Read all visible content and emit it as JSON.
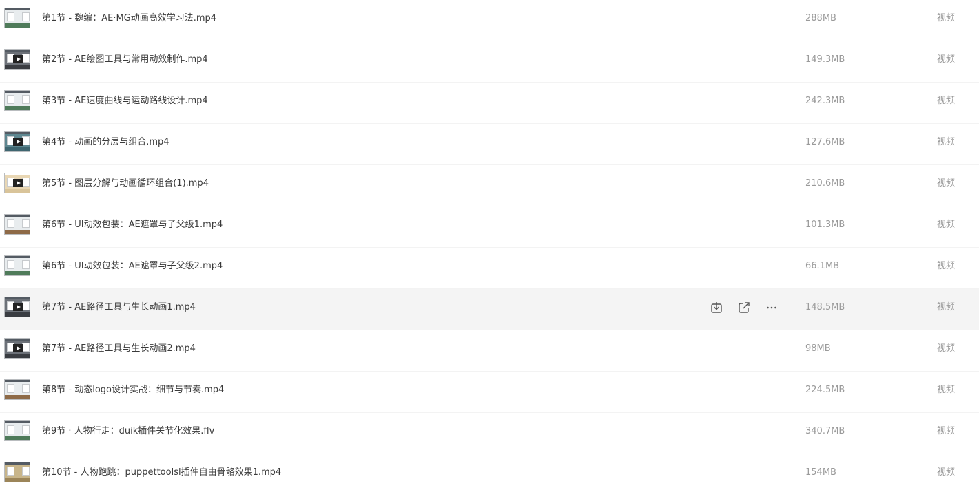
{
  "rows": [
    {
      "name": "第1节 - 魏编：AE·MG动画高效学习法.mp4",
      "size": "288MB",
      "type": "视频",
      "thumb": "t-light",
      "hovered": false
    },
    {
      "name": "第2节 - AE绘图工具与常用动效制作.mp4",
      "size": "149.3MB",
      "type": "视频",
      "thumb": "t-dark",
      "hovered": false
    },
    {
      "name": "第3节 - AE速度曲线与运动路线设计.mp4",
      "size": "242.3MB",
      "type": "视频",
      "thumb": "t-light",
      "hovered": false
    },
    {
      "name": "第4节 - 动画的分层与组合.mp4",
      "size": "127.6MB",
      "type": "视频",
      "thumb": "t-teal",
      "hovered": false
    },
    {
      "name": "第5节 - 图层分解与动画循环组合(1).mp4",
      "size": "210.6MB",
      "type": "视频",
      "thumb": "t-beige",
      "hovered": false
    },
    {
      "name": "第6节 - UI动效包装：AE遮罩与子父级1.mp4",
      "size": "101.3MB",
      "type": "视频",
      "thumb": "t-brown",
      "hovered": false
    },
    {
      "name": "第6节 - UI动效包装：AE遮罩与子父级2.mp4",
      "size": "66.1MB",
      "type": "视频",
      "thumb": "t-light",
      "hovered": false
    },
    {
      "name": "第7节 - AE路径工具与生长动画1.mp4",
      "size": "148.5MB",
      "type": "视频",
      "thumb": "t-dark",
      "hovered": true
    },
    {
      "name": "第7节 - AE路径工具与生长动画2.mp4",
      "size": "98MB",
      "type": "视频",
      "thumb": "t-dark",
      "hovered": false
    },
    {
      "name": "第8节 - 动态logo设计实战：细节与节奏.mp4",
      "size": "224.5MB",
      "type": "视频",
      "thumb": "t-brown",
      "hovered": false
    },
    {
      "name": "第9节 · 人物行走：duik插件关节化效果.flv",
      "size": "340.7MB",
      "type": "视频",
      "thumb": "t-light",
      "hovered": false
    },
    {
      "name": "第10节 - 人物跑跳：puppettoolsl插件自由骨骼效果1.mp4",
      "size": "154MB",
      "type": "视频",
      "thumb": "t-desert",
      "hovered": false
    }
  ],
  "icons": {
    "thumbnail": "video-thumbnail",
    "download": "download-icon",
    "share": "share-icon",
    "more": "more-icon"
  },
  "colors": {
    "hover_background": "#f4f4f4",
    "name_text": "#3a3a3a",
    "meta_text": "#9a9a9a"
  }
}
